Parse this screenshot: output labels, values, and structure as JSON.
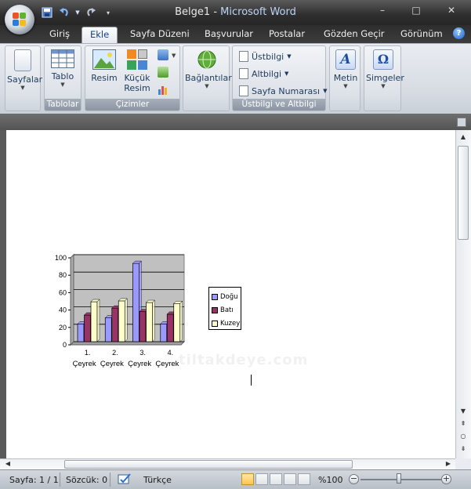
{
  "window": {
    "document_name": "Belge1",
    "separator": " - ",
    "app_name": "Microsoft Word",
    "minimize": "–",
    "maximize": "□",
    "close": "✕"
  },
  "quick_access": {
    "save_icon": "save-icon",
    "undo_icon": "undo-icon",
    "redo_icon": "redo-icon",
    "customize_icon": "customize-icon"
  },
  "tabs": [
    {
      "label": "Giriş"
    },
    {
      "label": "Ekle",
      "active": true
    },
    {
      "label": "Sayfa Düzeni"
    },
    {
      "label": "Başvurular"
    },
    {
      "label": "Postalar"
    },
    {
      "label": "Gözden Geçir"
    },
    {
      "label": "Görünüm"
    }
  ],
  "help": "?",
  "ribbon": {
    "pages": {
      "button": "Sayfalar"
    },
    "tables": {
      "button": "Tablo",
      "group": "Tablolar"
    },
    "illustrations": {
      "picture": "Resim",
      "clipart_line1": "Küçük",
      "clipart_line2": "Resim",
      "group": "Çizimler"
    },
    "links": {
      "button": "Bağlantılar"
    },
    "header_footer": {
      "header": "Üstbilgi",
      "footer": "Altbilgi",
      "page_number": "Sayfa Numarası",
      "group": "Üstbilgi ve Altbilgi"
    },
    "text": {
      "button": "Metin"
    },
    "symbols": {
      "button": "Simgeler"
    }
  },
  "document": {
    "watermark": "tiltakdeye.com"
  },
  "chart_data": {
    "type": "bar",
    "categories": [
      "1. Çeyrek",
      "2. Çeyrek",
      "3. Çeyrek",
      "4. Çeyrek"
    ],
    "category_line1": [
      "1.",
      "2.",
      "3.",
      "4."
    ],
    "category_line2": [
      "Çeyrek",
      "Çeyrek",
      "Çeyrek",
      "Çeyrek"
    ],
    "series": [
      {
        "name": "Doğu",
        "values": [
          20.4,
          27.4,
          90,
          20.4
        ],
        "color": "#9999ff"
      },
      {
        "name": "Batı",
        "values": [
          30.6,
          38.6,
          34.6,
          31.6
        ],
        "color": "#993366"
      },
      {
        "name": "Kuzey",
        "values": [
          45.9,
          46.9,
          45,
          43.9
        ],
        "color": "#ffffcc"
      }
    ],
    "yticks": [
      0,
      20,
      40,
      60,
      80,
      100
    ],
    "ylim": [
      0,
      100
    ],
    "plot_background": "#c0c0c0",
    "grid": true,
    "legend": "right"
  },
  "status": {
    "page": "Sayfa: 1 / 1",
    "words": "Sözcük: 0",
    "language": "Türkçe",
    "zoom": "%100",
    "zoom_out": "−",
    "zoom_in": "+"
  }
}
